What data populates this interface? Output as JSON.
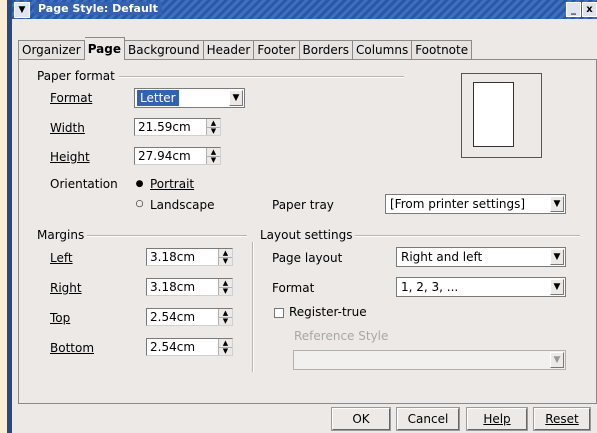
{
  "window": {
    "title": "Page Style: Default",
    "menu_icon": "chevron-down-icon",
    "minimize": "_",
    "close": "x"
  },
  "tabs": [
    {
      "label": "Organizer"
    },
    {
      "label": "Page"
    },
    {
      "label": "Background"
    },
    {
      "label": "Header"
    },
    {
      "label": "Footer"
    },
    {
      "label": "Borders"
    },
    {
      "label": "Columns"
    },
    {
      "label": "Footnote"
    }
  ],
  "paper_format": {
    "section_title": "Paper format",
    "format_label": "Format",
    "format_value": "Letter",
    "width_label": "Width",
    "width_value": "21.59cm",
    "height_label": "Height",
    "height_value": "27.94cm",
    "orientation_label": "Orientation",
    "portrait_label": "Portrait",
    "landscape_label": "Landscape",
    "paper_tray_label": "Paper tray",
    "paper_tray_value": "[From printer settings]"
  },
  "margins": {
    "section_title": "Margins",
    "left_label": "Left",
    "left_value": "3.18cm",
    "right_label": "Right",
    "right_value": "3.18cm",
    "top_label": "Top",
    "top_value": "2.54cm",
    "bottom_label": "Bottom",
    "bottom_value": "2.54cm"
  },
  "layout": {
    "section_title": "Layout settings",
    "page_layout_label": "Page layout",
    "page_layout_value": "Right and left",
    "format_label": "Format",
    "format_value": "1, 2, 3, ...",
    "register_true_label": "Register-true",
    "reference_style_label": "Reference Style",
    "reference_style_value": ""
  },
  "buttons": {
    "ok": "OK",
    "cancel": "Cancel",
    "help": "Help",
    "reset": "Reset"
  }
}
